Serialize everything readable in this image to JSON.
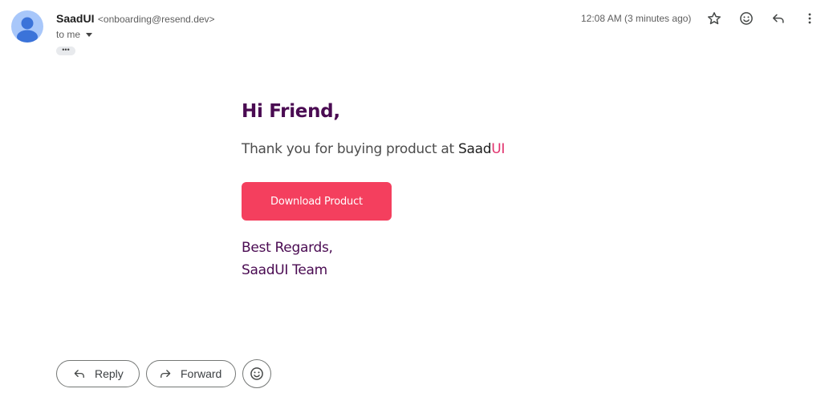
{
  "sender": {
    "name": "SaadUI",
    "email": "<onboarding@resend.dev>",
    "recipient_label": "to me",
    "avatar_color": "#a8c7fa"
  },
  "header": {
    "timestamp": "12:08 AM (3 minutes ago)",
    "more_label": "•••",
    "icons": [
      "star-icon",
      "emoji-icon",
      "reply-icon",
      "more-vert-icon"
    ]
  },
  "body": {
    "greeting": "Hi Friend,",
    "thanks_prefix": "Thank you for buying product at ",
    "brand_main": "Saad",
    "brand_accent": "UI",
    "download_label": "Download Product",
    "signoff_line1": "Best Regards,",
    "signoff_line2": "SaadUI Team",
    "button_color": "#f43f5e",
    "heading_color": "#4a0b52",
    "accent_color": "#e1306c"
  },
  "actions": {
    "reply_label": "Reply",
    "forward_label": "Forward"
  }
}
